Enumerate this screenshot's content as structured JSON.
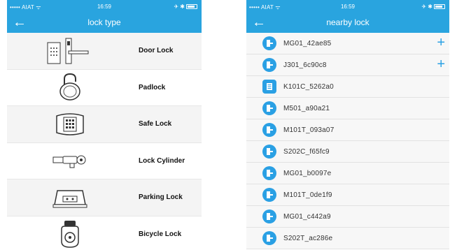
{
  "left": {
    "status": {
      "carrier": "••••• AIAT ᯤ",
      "time": "16:59",
      "battery": "✈ ✱"
    },
    "title": "lock type",
    "items": [
      {
        "label": "Door Lock",
        "icon": "door-lock-icon"
      },
      {
        "label": "Padlock",
        "icon": "padlock-icon"
      },
      {
        "label": "Safe Lock",
        "icon": "safe-lock-icon"
      },
      {
        "label": "Lock Cylinder",
        "icon": "lock-cylinder-icon"
      },
      {
        "label": "Parking Lock",
        "icon": "parking-lock-icon"
      },
      {
        "label": "Bicycle Lock",
        "icon": "bicycle-lock-icon"
      }
    ]
  },
  "right": {
    "status": {
      "carrier": "••••• AIAT ᯤ",
      "time": "16:59",
      "battery": "✈ ✱"
    },
    "title": "nearby lock",
    "locks": [
      {
        "name": "MG01_42ae85",
        "icon": "door-lock-icon",
        "add": "+"
      },
      {
        "name": "J301_6c90c8",
        "icon": "door-lock-icon",
        "add": "+"
      },
      {
        "name": "K101C_5262a0",
        "icon": "keypad-lock-icon"
      },
      {
        "name": "M501_a90a21",
        "icon": "door-lock-icon"
      },
      {
        "name": "M101T_093a07",
        "icon": "door-lock-icon"
      },
      {
        "name": "S202C_f65fc9",
        "icon": "door-lock-icon"
      },
      {
        "name": "MG01_b0097e",
        "icon": "door-lock-icon"
      },
      {
        "name": "M101T_0de1f9",
        "icon": "door-lock-icon"
      },
      {
        "name": "MG01_c442a9",
        "icon": "door-lock-icon"
      },
      {
        "name": "S202T_ac286e",
        "icon": "door-lock-icon"
      }
    ]
  },
  "colors": {
    "accent": "#29a4df",
    "icon_bg": "#2aa0e4"
  }
}
